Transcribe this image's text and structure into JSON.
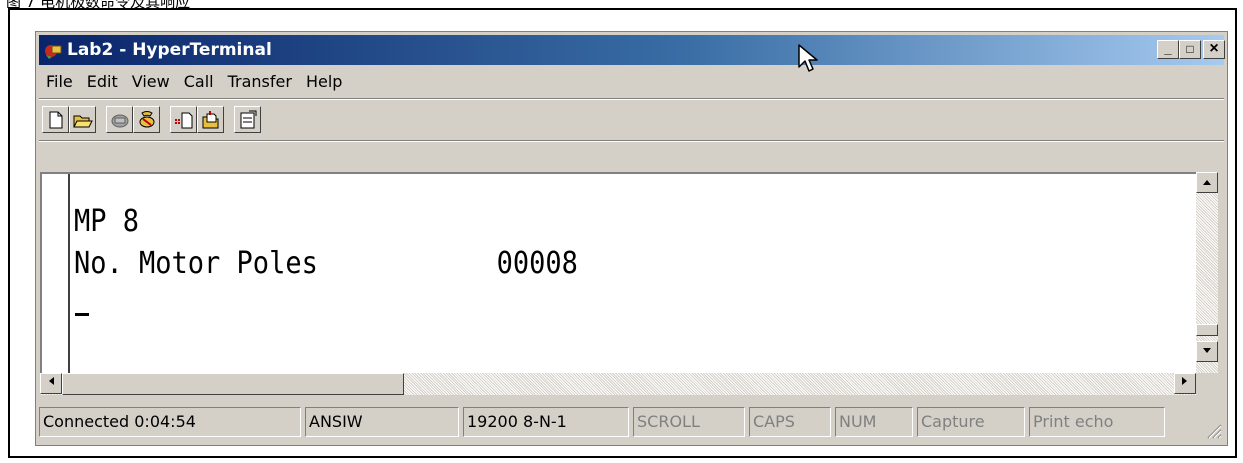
{
  "caption": "图 7 电机极数命令及其响应",
  "window": {
    "title": "Lab2 - HyperTerminal",
    "controls": {
      "minimize": "_",
      "maximize": "□",
      "close": "×"
    }
  },
  "menu": [
    "File",
    "Edit",
    "View",
    "Call",
    "Transfer",
    "Help"
  ],
  "toolbar": {
    "buttons": [
      "new-icon",
      "open-icon",
      "dial-icon",
      "disconnect-icon",
      "send-icon",
      "receive-icon",
      "properties-icon"
    ]
  },
  "terminal": {
    "lines": [
      "MP 8",
      "No. Motor Poles           00008"
    ]
  },
  "status": {
    "connected": "Connected 0:04:54",
    "emulation": "ANSIW",
    "port_settings": "19200 8-N-1",
    "scroll": "SCROLL",
    "caps": "CAPS",
    "num": "NUM",
    "capture": "Capture",
    "print_echo": "Print echo"
  },
  "colors": {
    "title_start": "#0a246a",
    "title_end": "#a6caf0",
    "chrome": "#d4d0c8"
  }
}
